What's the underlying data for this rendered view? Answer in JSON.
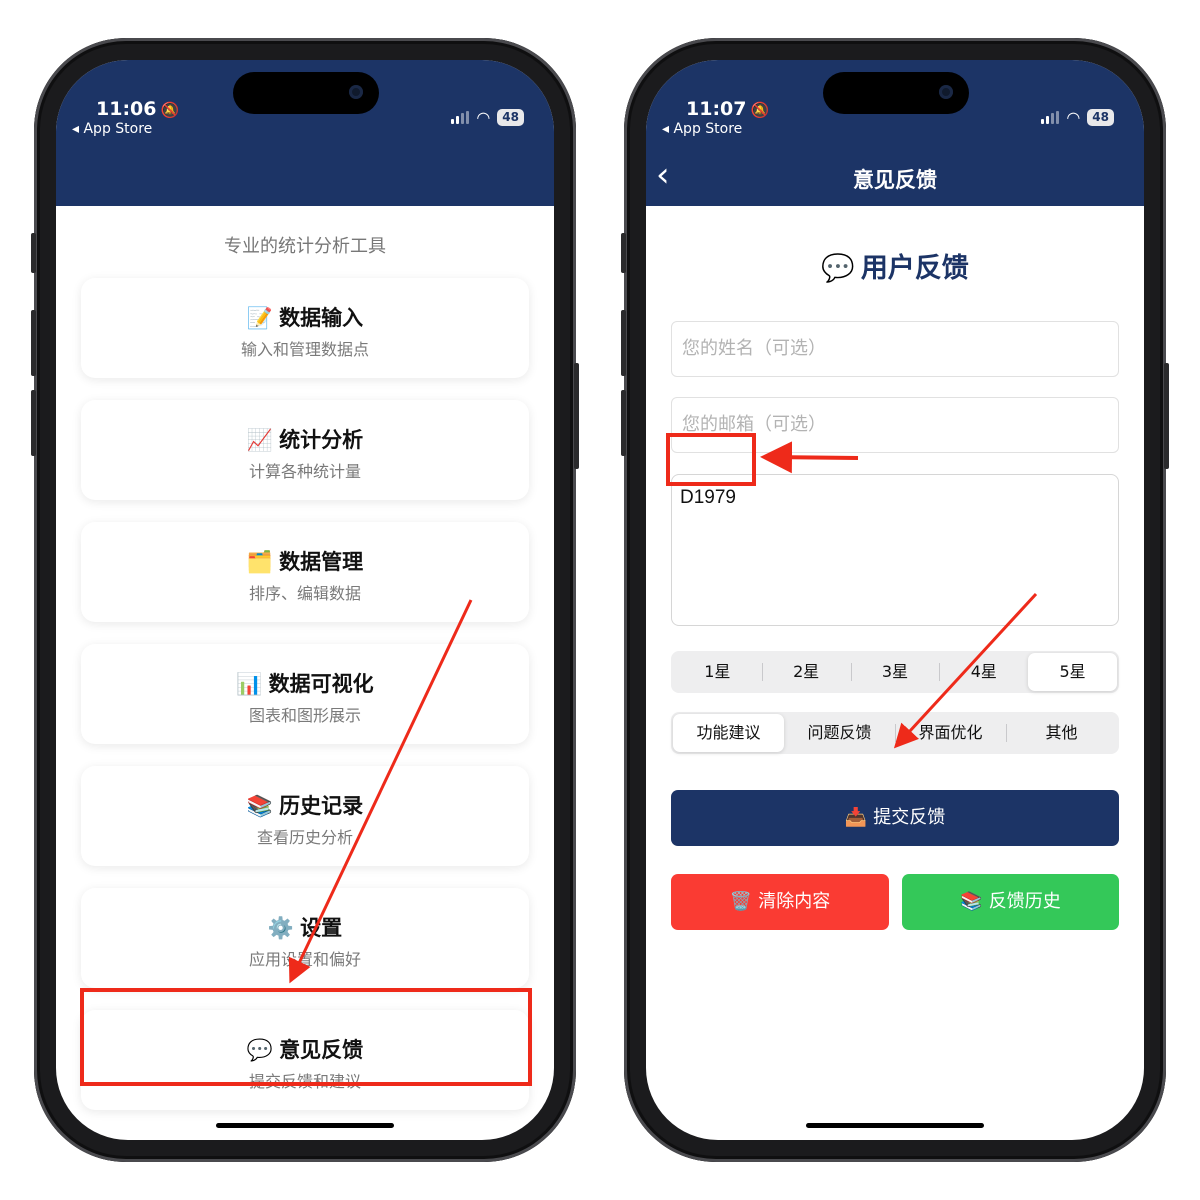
{
  "left": {
    "status": {
      "time": "11:06",
      "back_app": "◂ App Store",
      "battery": "48"
    },
    "subtitle": "专业的统计分析工具",
    "menu": [
      {
        "emoji": "📝",
        "title": "数据输入",
        "desc": "输入和管理数据点"
      },
      {
        "emoji": "📈",
        "title": "统计分析",
        "desc": "计算各种统计量"
      },
      {
        "emoji": "🗂️",
        "title": "数据管理",
        "desc": "排序、编辑数据"
      },
      {
        "emoji": "📊",
        "title": "数据可视化",
        "desc": "图表和图形展示"
      },
      {
        "emoji": "📚",
        "title": "历史记录",
        "desc": "查看历史分析"
      },
      {
        "emoji": "⚙️",
        "title": "设置",
        "desc": "应用设置和偏好"
      },
      {
        "emoji": "💬",
        "title": "意见反馈",
        "desc": "提交反馈和建议"
      }
    ]
  },
  "right": {
    "status": {
      "time": "11:07",
      "back_app": "◂ App Store",
      "battery": "48"
    },
    "nav_title": "意见反馈",
    "heading": {
      "emoji": "💬",
      "text": "用户反馈"
    },
    "name_placeholder": "您的姓名（可选）",
    "email_placeholder": "您的邮箱（可选）",
    "feedback_text": "D1979",
    "ratings": [
      "1星",
      "2星",
      "3星",
      "4星",
      "5星"
    ],
    "categories": [
      "功能建议",
      "问题反馈",
      "界面优化",
      "其他"
    ],
    "submit": {
      "emoji": "📥",
      "label": "提交反馈"
    },
    "clear": {
      "emoji": "🗑️",
      "label": "清除内容"
    },
    "history": {
      "emoji": "📚",
      "label": "反馈历史"
    }
  },
  "colors": {
    "header": "#1c3466",
    "submit": "#1c3466",
    "clear": "#fa3b33",
    "history": "#34c859",
    "annotation": "#ee2a1a"
  }
}
